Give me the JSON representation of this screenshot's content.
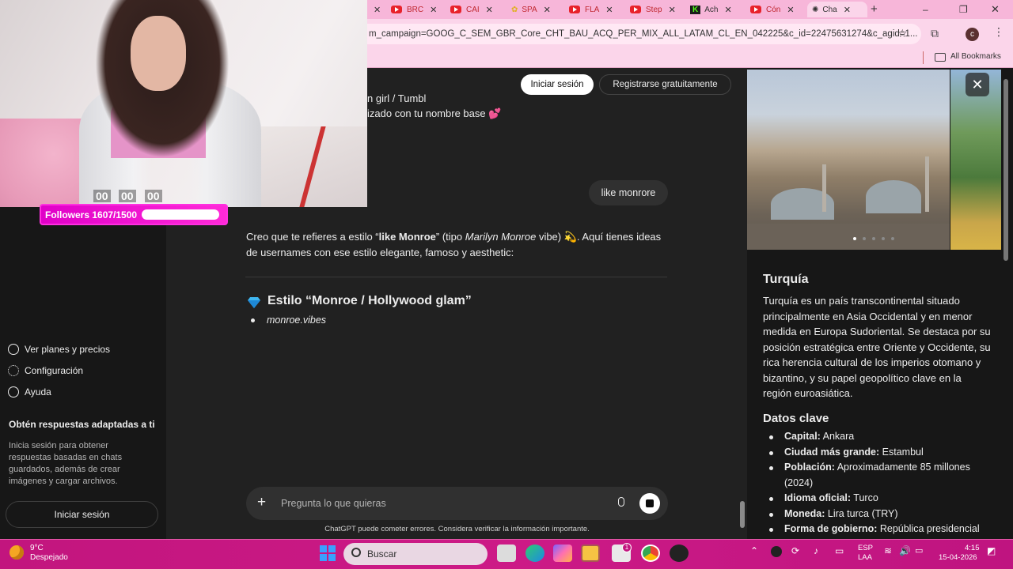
{
  "browser": {
    "tabs": [
      {
        "label": "BRC"
      },
      {
        "label": "CAI"
      },
      {
        "label": "SPA"
      },
      {
        "label": "FLA"
      },
      {
        "label": "Step"
      },
      {
        "label": "Ach"
      },
      {
        "label": "Cón"
      },
      {
        "label": "Cha"
      }
    ],
    "url": "m_campaign=GOOG_C_SEM_GBR_Core_CHT_BAU_ACQ_PER_MIX_ALL_LATAM_CL_EN_042225&c_id=22475631274&c_agid=1...",
    "avatar_letter": "c",
    "bookmarks_label": "All Bookmarks",
    "new_tab": "+",
    "win_controls": [
      "–",
      "❐",
      "✕"
    ]
  },
  "stream": {
    "counters": [
      "00",
      "00",
      "00"
    ],
    "followers_label": "Followers 1607/1500",
    "followers_progress": 1.0
  },
  "sidebar": {
    "items": [
      {
        "label": "Ver planes y precios",
        "icon": "sparkle-icon"
      },
      {
        "label": "Configuración",
        "icon": "gear-icon"
      },
      {
        "label": "Ayuda",
        "icon": "help-icon"
      }
    ],
    "promo_title": "Obtén respuestas adaptadas a ti",
    "promo_body": "Inicia sesión para obtener respuestas basadas en chats guardados, además de crear imágenes y cargar archivos.",
    "login": "Iniciar sesión"
  },
  "header": {
    "login": "Iniciar sesión",
    "signup": "Registrarse gratuitamente"
  },
  "chat": {
    "prev_line1": "n girl / Tumbl",
    "prev_line2": "izado con tu nombre base 💕",
    "user_message": "like monrore",
    "reply_intro_a": "Creo que te refieres a estilo “",
    "reply_intro_bold": "like Monroe",
    "reply_intro_b": "” (tipo ",
    "reply_intro_italic": "Marilyn Monroe",
    "reply_intro_c": " vibe) 💫. Aquí tienes ideas",
    "reply_line2": "de usernames con ese estilo elegante, famoso y aesthetic:",
    "section_title": "Estilo “Monroe / Hollywood glam”",
    "bullet_item": "monroe.vibes",
    "composer_placeholder": "Pregunta lo que quieras",
    "disclaimer": "ChatGPT puede cometer errores. Considera verificar la información importante."
  },
  "panel": {
    "title": "Turquía",
    "description": "Turquía es un país transcontinental situado principalmente en Asia Occidental y en menor medida en Europa Sudoriental. Se destaca por su posición estratégica entre Oriente y Occidente, su rica herencia cultural de los imperios otomano y bizantino, y su papel geopolítico clave en la región euroasiática.",
    "subtitle": "Datos clave",
    "facts": [
      {
        "key": "Capital:",
        "value": " Ankara"
      },
      {
        "key": "Ciudad más grande:",
        "value": " Estambul"
      },
      {
        "key": "Población:",
        "value": " Aproximadamente 85 millones (2024)"
      },
      {
        "key": "Idioma oficial:",
        "value": " Turco"
      },
      {
        "key": "Moneda:",
        "value": " Lira turca (TRY)"
      },
      {
        "key": "Forma de gobierno:",
        "value": " República presidencial"
      }
    ],
    "close": "✕"
  },
  "taskbar": {
    "weather_temp": "9°C",
    "weather_desc": "Despejado",
    "search_placeholder": "Buscar",
    "lang_top": "ESP",
    "lang_bottom": "LAA",
    "time": "4:15",
    "date": "15-04-2026",
    "store_badge": "1"
  },
  "colors": {
    "accent_pink": "#cc1a86",
    "chat_bg": "#212121",
    "sidebar_bg": "#171717"
  }
}
